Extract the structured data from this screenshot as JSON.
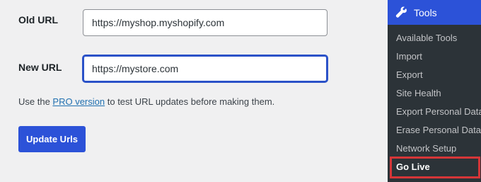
{
  "form": {
    "old_label": "Old URL",
    "old_value": "https://myshop.myshopify.com",
    "new_label": "New URL",
    "new_value": "https://mystore.com",
    "help_before": "Use the ",
    "help_link": "PRO version",
    "help_after": " to test URL updates before making them.",
    "update_button": "Update Urls"
  },
  "menu": {
    "header_icon": "wrench-icon",
    "header_label": "Tools",
    "items": [
      {
        "label": "Available Tools"
      },
      {
        "label": "Import"
      },
      {
        "label": "Export"
      },
      {
        "label": "Site Health"
      },
      {
        "label": "Export Personal Data"
      },
      {
        "label": "Erase Personal Data"
      },
      {
        "label": "Network Setup"
      },
      {
        "label": "Go Live"
      }
    ],
    "active_item": "Go Live"
  },
  "colors": {
    "accent": "#2c52d8",
    "highlight": "#d63638",
    "menu_bg": "#1d2327",
    "submenu_bg": "#2c3338"
  }
}
